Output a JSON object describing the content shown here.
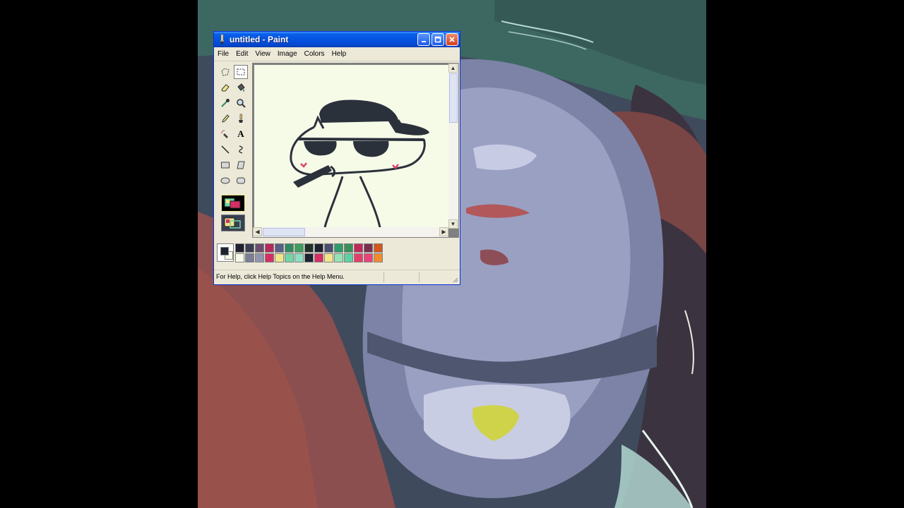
{
  "window": {
    "title": "untitled - Paint",
    "app_icon": "paint-brush-icon",
    "controls": [
      "minimize-icon",
      "maximize-icon",
      "close-icon"
    ]
  },
  "menu": {
    "items": [
      "File",
      "Edit",
      "View",
      "Image",
      "Colors",
      "Help"
    ]
  },
  "toolbox": {
    "tools": [
      {
        "icon": "free-form-select-icon"
      },
      {
        "icon": "rect-select-icon",
        "selected": true
      },
      {
        "icon": "eraser-icon"
      },
      {
        "icon": "fill-bucket-icon"
      },
      {
        "icon": "color-picker-icon"
      },
      {
        "icon": "magnifier-icon"
      },
      {
        "icon": "pencil-icon"
      },
      {
        "icon": "brush-icon"
      },
      {
        "icon": "airbrush-icon"
      },
      {
        "icon": "text-icon",
        "glyph": "A"
      },
      {
        "icon": "line-icon"
      },
      {
        "icon": "curve-icon"
      },
      {
        "icon": "rectangle-icon"
      },
      {
        "icon": "polygon-icon"
      },
      {
        "icon": "ellipse-icon"
      },
      {
        "icon": "rounded-rect-icon"
      }
    ]
  },
  "palette": {
    "foreground": "#1d2330",
    "background": "#f6fbe8",
    "colors_top": [
      "#1d2330",
      "#3a3f52",
      "#6b4e6e",
      "#b42a5a",
      "#5a5f86",
      "#2e8a62",
      "#3d9e5e",
      "#20302c",
      "#1d2330",
      "#4b4f6e",
      "#2f9a6a",
      "#3a8e5a",
      "#c0295a",
      "#7a3050",
      "#d2581e"
    ],
    "colors_bottom": [
      "#f6fbe8",
      "#7a7f96",
      "#9296b0",
      "#d52f66",
      "#f3e58a",
      "#6fd7a6",
      "#8be0c4",
      "#1d2330",
      "#d52f66",
      "#f3e58a",
      "#96e3b6",
      "#5fd0a2",
      "#e2406a",
      "#e8437a",
      "#f08c2e"
    ]
  },
  "statusbar": {
    "text": "For Help, click Help Topics on the Help Menu."
  }
}
